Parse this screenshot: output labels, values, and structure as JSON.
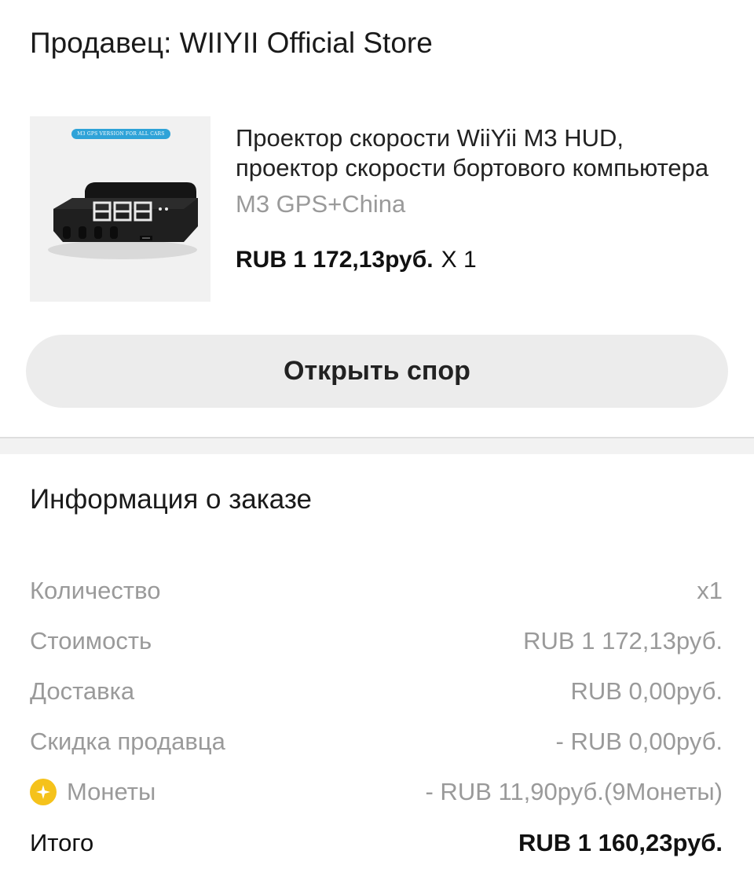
{
  "seller": {
    "label": "Продавец: WIIYII Official Store"
  },
  "product": {
    "image_badge_text": "M3 GPS VERSION FOR ALL CARS",
    "title_line1": "Проектор скорости WiiYii M3 HUD,",
    "title_line2": "проектор скорости бортового компьютера",
    "variant": "M3 GPS+China",
    "price": "RUB 1 172,13руб.",
    "quantity": "X 1"
  },
  "actions": {
    "open_dispute_label": "Открыть спор"
  },
  "order_info": {
    "title": "Информация о заказе",
    "rows": [
      {
        "label": "Количество",
        "value": "x1"
      },
      {
        "label": "Стоимость",
        "value": "RUB 1 172,13руб."
      },
      {
        "label": "Доставка",
        "value": "RUB 0,00руб."
      },
      {
        "label": "Скидка продавца",
        "value": "- RUB 0,00руб."
      },
      {
        "label": "Монеты",
        "value": "- RUB 11,90руб.(9Монеты)",
        "icon": "coin-icon"
      }
    ],
    "total": {
      "label": "Итого",
      "value": "RUB 1 160,23руб."
    }
  },
  "colors": {
    "coin": "#f5c21b",
    "button_bg": "#ececec",
    "muted_text": "#9a9a9a"
  }
}
